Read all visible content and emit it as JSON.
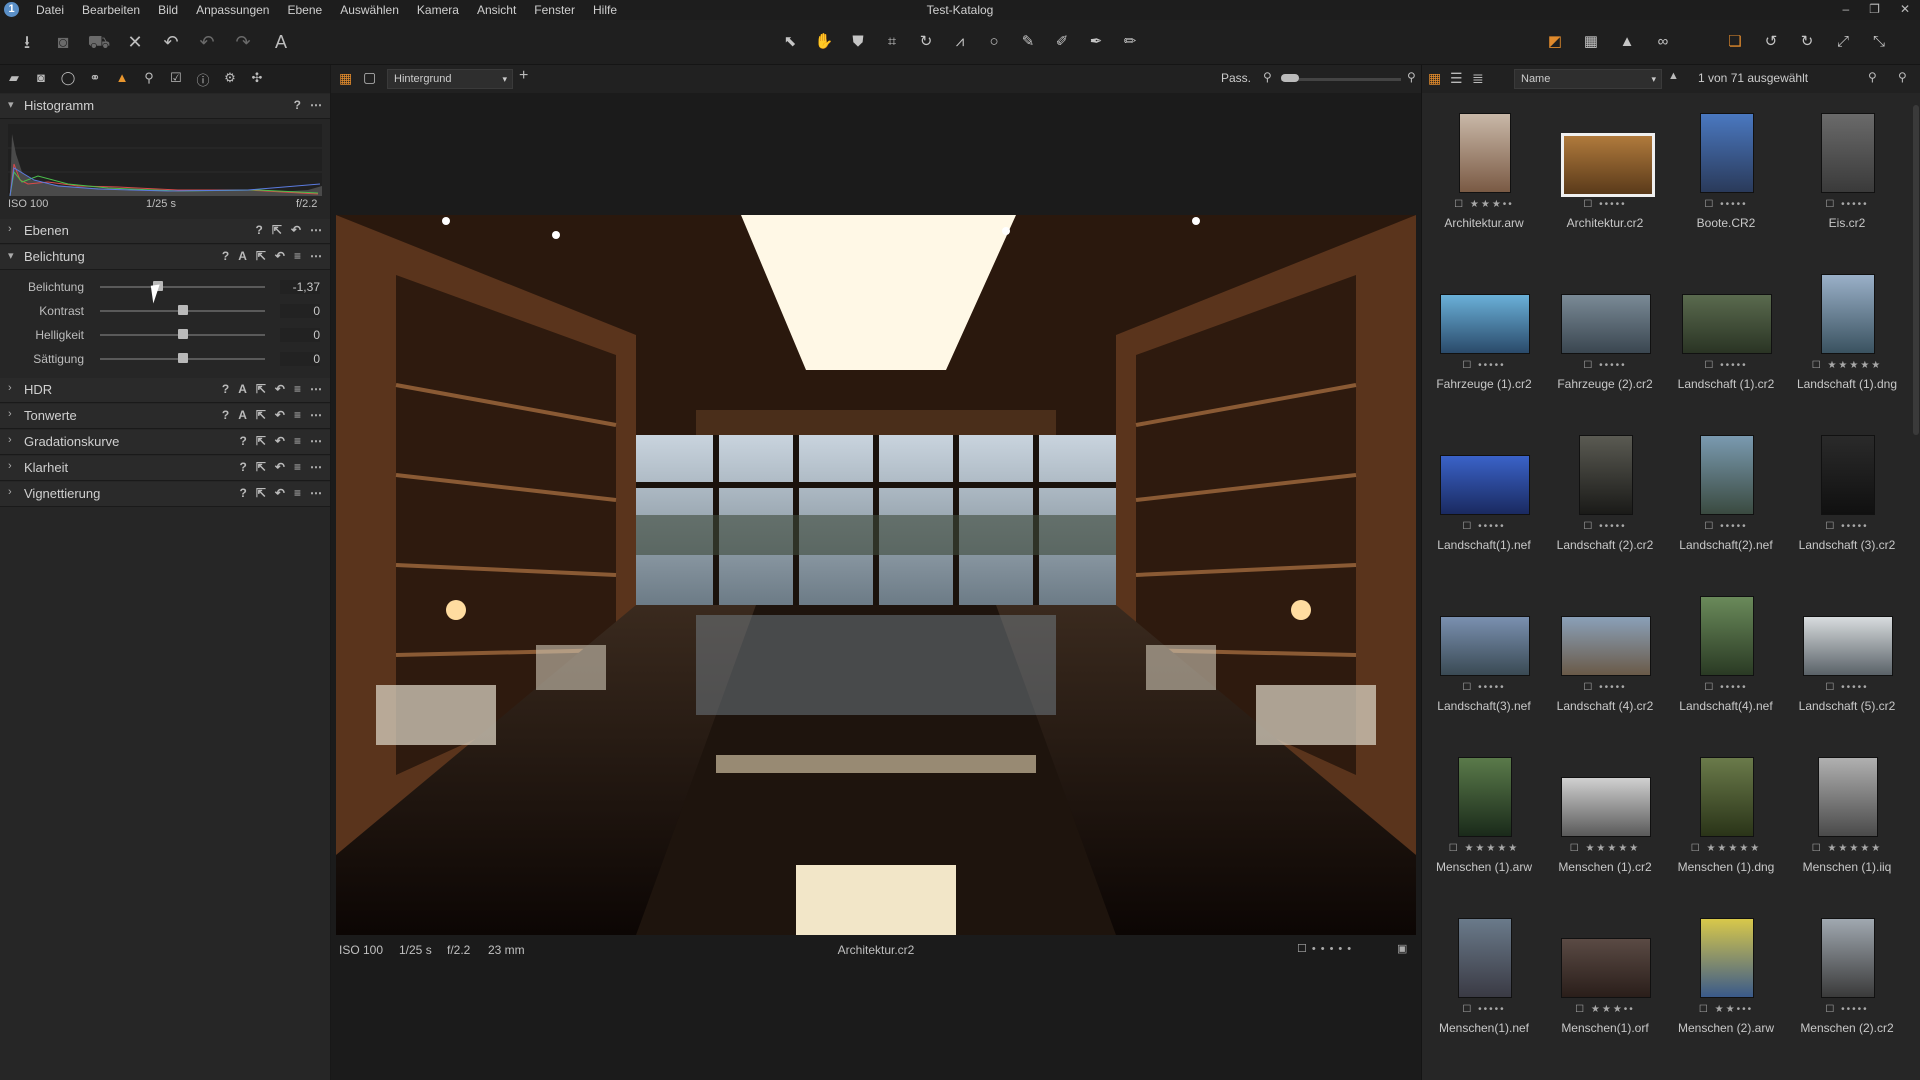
{
  "window": {
    "title": "Test-Katalog"
  },
  "menu": [
    "Datei",
    "Bearbeiten",
    "Bild",
    "Anpassungen",
    "Ebene",
    "Auswählen",
    "Kamera",
    "Ansicht",
    "Fenster",
    "Hilfe"
  ],
  "tool_tabs": [
    "library-icon",
    "camera-icon",
    "lens-icon",
    "color-icon",
    "exposure-icon",
    "details-icon",
    "adjustments-icon",
    "metadata-icon",
    "output-icon",
    "batch-icon"
  ],
  "histogram": {
    "title": "Histogramm",
    "iso": "ISO 100",
    "shutter": "1/25 s",
    "aperture": "f/2.2"
  },
  "sections": {
    "ebenen": "Ebenen",
    "belichtung": "Belichtung",
    "hdr": "HDR",
    "tonwerte": "Tonwerte",
    "gradation": "Gradationskurve",
    "klarheit": "Klarheit",
    "vignettierung": "Vignettierung"
  },
  "exposure_sliders": [
    {
      "label": "Belichtung",
      "value": "-1,37",
      "level": 0.35
    },
    {
      "label": "Kontrast",
      "value": "0",
      "level": 0.5
    },
    {
      "label": "Helligkeit",
      "value": "0",
      "level": 0.5
    },
    {
      "label": "Sättigung",
      "value": "0",
      "level": 0.5
    }
  ],
  "viewer": {
    "layer_select": "Hintergrund",
    "zoom_label": "Pass.",
    "iso": "ISO 100",
    "shutter": "1/25 s",
    "aperture": "f/2.2",
    "focal": "23 mm",
    "filename": "Architektur.cr2"
  },
  "browser": {
    "sort_select": "Name",
    "count": "1 von 71 ausgewählt",
    "thumbs": [
      {
        "name": "Architektur.arw",
        "stars": 3,
        "selected": false
      },
      {
        "name": "Architektur.cr2",
        "stars": 0,
        "selected": true
      },
      {
        "name": "Boote.CR2",
        "stars": 0,
        "selected": false
      },
      {
        "name": "Eis.cr2",
        "stars": 0,
        "selected": false
      },
      {
        "name": "Fahrzeuge (1).cr2",
        "stars": 0,
        "selected": false
      },
      {
        "name": "Fahrzeuge (2).cr2",
        "stars": 0,
        "selected": false
      },
      {
        "name": "Landschaft (1).cr2",
        "stars": 0,
        "selected": false
      },
      {
        "name": "Landschaft (1).dng",
        "stars": 5,
        "selected": false
      },
      {
        "name": "Landschaft(1).nef",
        "stars": 0,
        "selected": false
      },
      {
        "name": "Landschaft (2).cr2",
        "stars": 0,
        "selected": false
      },
      {
        "name": "Landschaft(2).nef",
        "stars": 0,
        "selected": false
      },
      {
        "name": "Landschaft (3).cr2",
        "stars": 0,
        "selected": false
      },
      {
        "name": "Landschaft(3).nef",
        "stars": 0,
        "selected": false
      },
      {
        "name": "Landschaft (4).cr2",
        "stars": 0,
        "selected": false
      },
      {
        "name": "Landschaft(4).nef",
        "stars": 0,
        "selected": false
      },
      {
        "name": "Landschaft (5).cr2",
        "stars": 0,
        "selected": false
      },
      {
        "name": "Menschen (1).arw",
        "stars": 5,
        "selected": false
      },
      {
        "name": "Menschen (1).cr2",
        "stars": 5,
        "selected": false
      },
      {
        "name": "Menschen (1).dng",
        "stars": 5,
        "selected": false
      },
      {
        "name": "Menschen (1).iiq",
        "stars": 5,
        "selected": false
      },
      {
        "name": "Menschen(1).nef",
        "stars": 0,
        "selected": false
      },
      {
        "name": "Menschen(1).orf",
        "stars": 3,
        "selected": false
      },
      {
        "name": "Menschen (2).arw",
        "stars": 2,
        "selected": false
      },
      {
        "name": "Menschen (2).cr2",
        "stars": 0,
        "selected": false
      }
    ]
  }
}
